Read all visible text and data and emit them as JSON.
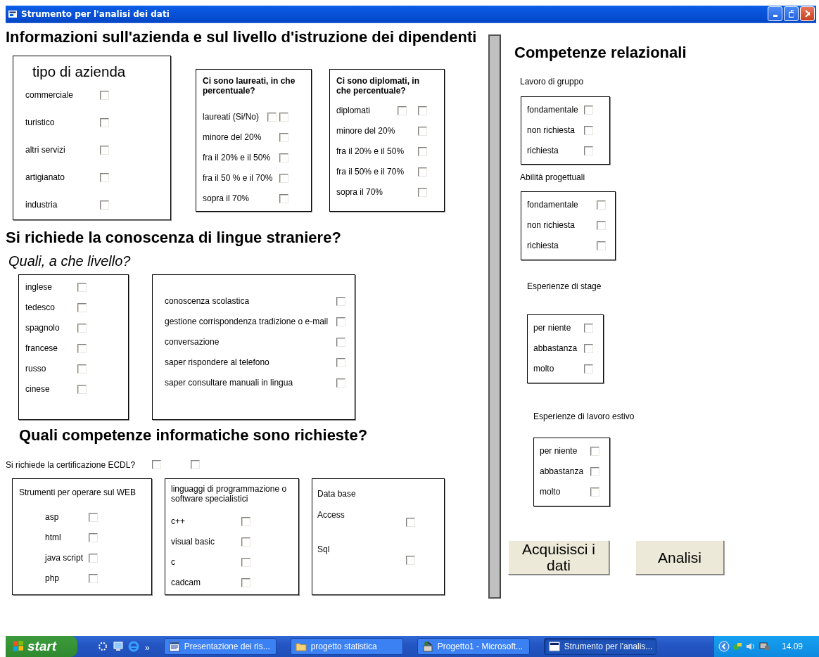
{
  "window": {
    "title": "Strumento per l'analisi dei dati"
  },
  "company_section": {
    "heading": "Informazioni sull'azienda e sul livello d'istruzione dei dipendenti",
    "groups": [
      {
        "title": "tipo di azienda",
        "options": [
          {
            "label": "commerciale",
            "checked": false
          },
          {
            "label": "turistico",
            "checked": false
          },
          {
            "label": "altri servizi",
            "checked": false
          },
          {
            "label": "artigianato",
            "checked": false
          },
          {
            "label": "industria",
            "checked": false
          }
        ]
      },
      {
        "title": "Ci sono laureati, in che percentuale?",
        "options": [
          {
            "label": "laureati (Si/No)",
            "checkboxes": [
              {
                "checked": false
              },
              {
                "checked": false
              }
            ]
          },
          {
            "label": "minore del 20%",
            "checked": false
          },
          {
            "label": "fra il 20% e il 50%",
            "checked": false
          },
          {
            "label": "fra il 50 % e il 70%",
            "checked": false
          },
          {
            "label": "sopra il 70%",
            "checked": false
          }
        ]
      },
      {
        "title": "Ci sono diplomati, in che percentuale?",
        "options": [
          {
            "label": "diplomati",
            "checkboxes": [
              {
                "checked": false
              },
              {
                "checked": false
              }
            ]
          },
          {
            "label": "minore del 20%",
            "checked": false
          },
          {
            "label": "fra il 20% e il 50%",
            "checked": false
          },
          {
            "label": "fra il 50% e il 70%",
            "checked": false
          },
          {
            "label": "sopra il 70%",
            "checked": false
          }
        ]
      }
    ]
  },
  "languages_section": {
    "heading": "Si richiede la conoscenza di lingue straniere?",
    "subheading": "Quali, a che livello?",
    "groups": [
      {
        "options": [
          {
            "label": "inglese",
            "checked": false
          },
          {
            "label": "tedesco",
            "checked": false
          },
          {
            "label": "spagnolo",
            "checked": false
          },
          {
            "label": "francese",
            "checked": false
          },
          {
            "label": "russo",
            "checked": false
          },
          {
            "label": "cinese",
            "checked": false
          }
        ]
      },
      {
        "options": [
          {
            "label": "conoscenza scolastica",
            "checked": false
          },
          {
            "label": "gestione corrispondenza tradizione o e-mail",
            "checked": false
          },
          {
            "label": "conversazione",
            "checked": false
          },
          {
            "label": "saper rispondere al telefono",
            "checked": false
          },
          {
            "label": "saper consultare manuali in lingua",
            "checked": false
          }
        ]
      }
    ]
  },
  "it_section": {
    "heading": "Quali competenze informatiche sono richieste?",
    "ecdl": {
      "label": "Si richiede la certificazione ECDL?",
      "checkboxes": [
        {
          "checked": false
        },
        {
          "checked": false
        }
      ]
    },
    "groups": [
      {
        "title": "Strumenti per operare sul WEB",
        "options": [
          {
            "label": "asp",
            "checked": false
          },
          {
            "label": "html",
            "checked": false
          },
          {
            "label": "java script",
            "checked": false
          },
          {
            "label": "php",
            "checked": false
          }
        ]
      },
      {
        "title": "linguaggi di programmazione o software specialistici",
        "options": [
          {
            "label": "c++",
            "checked": false
          },
          {
            "label": "visual basic",
            "checked": false
          },
          {
            "label": "c",
            "checked": false
          },
          {
            "label": "cadcam",
            "checked": false
          }
        ]
      },
      {
        "title": "Data base",
        "options": [
          {
            "label": "Access",
            "checked": false
          },
          {
            "label": "Sql",
            "checked": false
          }
        ]
      }
    ]
  },
  "relational_section": {
    "heading": "Competenze relazionali",
    "groups": [
      {
        "title": "Lavoro di gruppo",
        "options": [
          {
            "label": "fondamentale",
            "checked": false
          },
          {
            "label": "non richiesta",
            "checked": false
          },
          {
            "label": "richiesta",
            "checked": false
          }
        ]
      },
      {
        "title": "Abilità progettuali",
        "options": [
          {
            "label": "fondamentale",
            "checked": false
          },
          {
            "label": "non richiesta",
            "checked": false
          },
          {
            "label": "richiesta",
            "checked": false
          }
        ]
      },
      {
        "title": "Esperienze di stage",
        "options": [
          {
            "label": "per niente",
            "checked": false
          },
          {
            "label": "abbastanza",
            "checked": false
          },
          {
            "label": "molto",
            "checked": false
          }
        ]
      },
      {
        "title": "Esperienze di lavoro estivo",
        "options": [
          {
            "label": "per niente",
            "checked": false
          },
          {
            "label": "abbastanza",
            "checked": false
          },
          {
            "label": "molto",
            "checked": false
          }
        ]
      }
    ]
  },
  "buttons": [
    {
      "label": "Acquisisci i dati"
    },
    {
      "label": "Analisi"
    }
  ],
  "taskbar": {
    "start": "start",
    "more": "»",
    "tasks": [
      {
        "label": "Presentazione dei ris...",
        "kind": "document",
        "selected": false
      },
      {
        "label": "progetto statistica",
        "kind": "folder",
        "selected": false
      },
      {
        "label": "Progetto1 - Microsoft...",
        "kind": "program",
        "selected": false
      },
      {
        "label": "Strumento per l'analis...",
        "kind": "window",
        "selected": true
      }
    ],
    "clock": "14.09"
  }
}
